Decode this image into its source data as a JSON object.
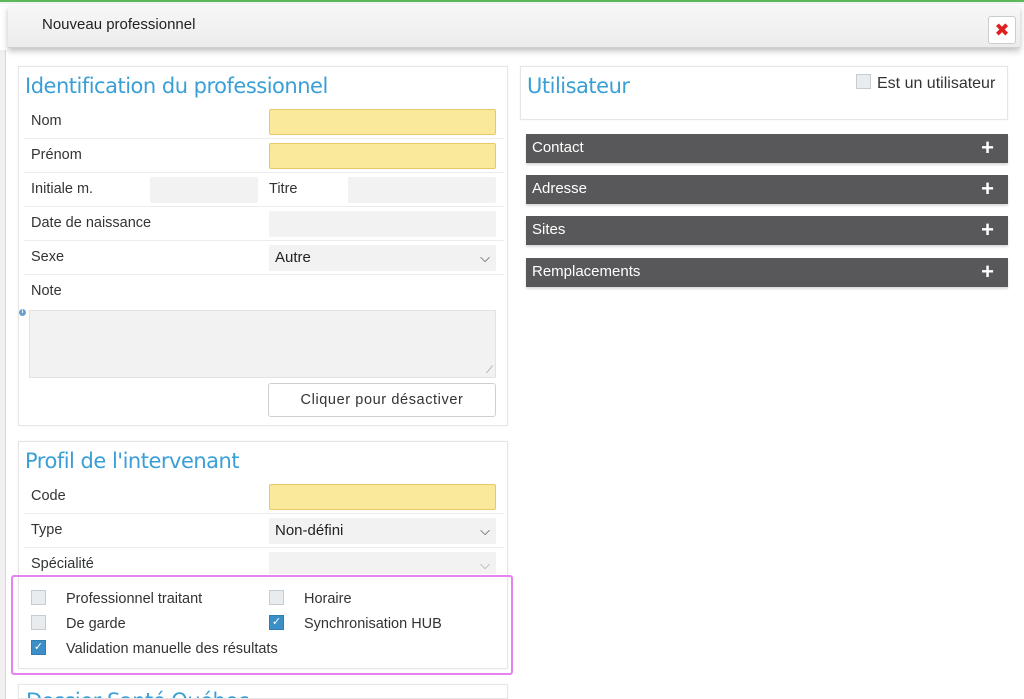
{
  "window": {
    "title": "Nouveau professionnel",
    "close_icon": "close-icon",
    "close_glyph": "✖"
  },
  "identification": {
    "title": "Identification du professionnel",
    "nom_label": "Nom",
    "prenom_label": "Prénom",
    "initiale_label": "Initiale m.",
    "titre_label": "Titre",
    "date_label": "Date de naissance",
    "sexe_label": "Sexe",
    "sexe_value": "Autre",
    "note_label": "Note",
    "deactivate_button": "Cliquer pour désactiver"
  },
  "profil": {
    "title": "Profil de l'intervenant",
    "code_label": "Code",
    "type_label": "Type",
    "type_value": "Non-défini",
    "specialite_label": "Spécialité",
    "checkboxes": {
      "traitant": {
        "label": "Professionnel traitant",
        "checked": false
      },
      "horaire": {
        "label": "Horaire",
        "checked": false
      },
      "garde": {
        "label": "De garde",
        "checked": false
      },
      "hub": {
        "label": "Synchronisation HUB",
        "checked": true
      },
      "validation": {
        "label": "Validation manuelle des résultats",
        "checked": true
      }
    }
  },
  "next_section_title": "Dossier Santé Québec",
  "utilisateur": {
    "title": "Utilisateur",
    "est_utilisateur_label": "Est un utilisateur",
    "est_utilisateur_checked": false
  },
  "accordions": [
    {
      "label": "Contact"
    },
    {
      "label": "Adresse"
    },
    {
      "label": "Sites"
    },
    {
      "label": "Remplacements"
    }
  ],
  "glyphs": {
    "plus": "+",
    "chevron": "⌵",
    "check": "✓",
    "info": "i",
    "resize": "⟋"
  },
  "colors": {
    "accent": "#3a9fd6",
    "required": "#fae99a",
    "accordion": "#58585a",
    "highlight": "#e681f0",
    "close": "#e02020"
  }
}
